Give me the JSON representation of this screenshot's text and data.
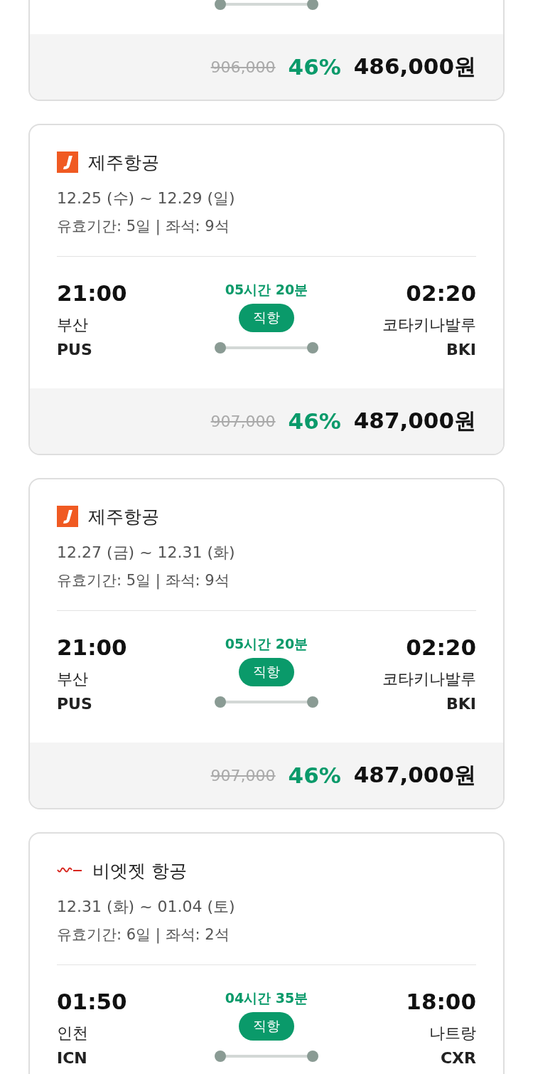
{
  "top_card": {
    "original_price": "906,000",
    "discount": "46%",
    "price": "486,000원"
  },
  "deals": [
    {
      "kind": "jeju",
      "airline": "제주항공",
      "dates": "12.25 (수) ~ 12.29 (일)",
      "validity": "유효기간: 5일 | 좌석: 9석",
      "depart_time": "21:00",
      "depart_city": "부산",
      "depart_code": "PUS",
      "duration": "05시간 20분",
      "route_type": "직항",
      "arrive_time": "02:20",
      "arrive_city": "코타키나발루",
      "arrive_code": "BKI",
      "original_price": "907,000",
      "discount": "46%",
      "price": "487,000원"
    },
    {
      "kind": "jeju",
      "airline": "제주항공",
      "dates": "12.27 (금) ~ 12.31 (화)",
      "validity": "유효기간: 5일 | 좌석: 9석",
      "depart_time": "21:00",
      "depart_city": "부산",
      "depart_code": "PUS",
      "duration": "05시간 20분",
      "route_type": "직항",
      "arrive_time": "02:20",
      "arrive_city": "코타키나발루",
      "arrive_code": "BKI",
      "original_price": "907,000",
      "discount": "46%",
      "price": "487,000원"
    },
    {
      "kind": "vietjet",
      "airline": "비엣젯 항공",
      "dates": "12.31 (화) ~ 01.04 (토)",
      "validity": "유효기간: 6일 | 좌석: 2석",
      "depart_time": "01:50",
      "depart_city": "인천",
      "depart_code": "ICN",
      "duration": "04시간 35분",
      "route_type": "직항",
      "arrive_time": "18:00",
      "arrive_city": "나트랑",
      "arrive_code": "CXR"
    }
  ]
}
